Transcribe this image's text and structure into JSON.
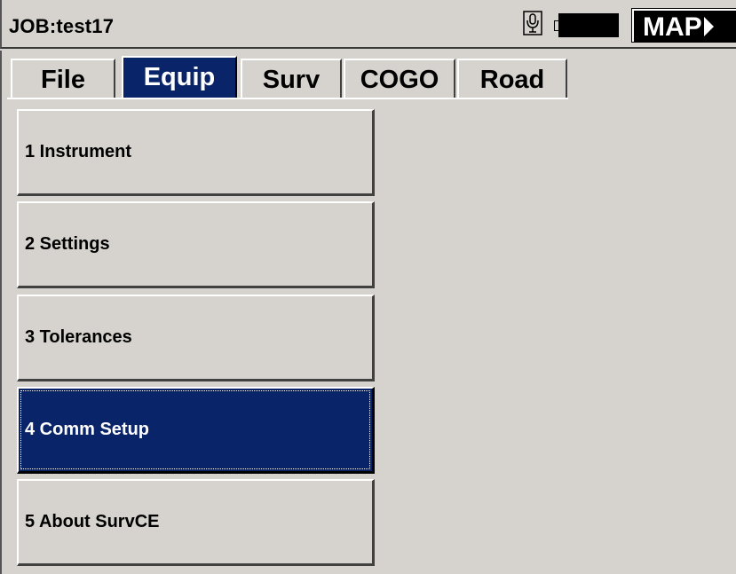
{
  "header": {
    "job_title": "JOB:test17",
    "map_label": "MAP",
    "icons": [
      "microphone-icon",
      "battery-icon",
      "map-arrow-icon"
    ]
  },
  "tabs": [
    {
      "label": "File",
      "active": false
    },
    {
      "label": "Equip",
      "active": true
    },
    {
      "label": "Surv",
      "active": false
    },
    {
      "label": "COGO",
      "active": false
    },
    {
      "label": "Road",
      "active": false
    }
  ],
  "menu": {
    "selected_index": 3,
    "items": [
      {
        "label": "1 Instrument"
      },
      {
        "label": "2 Settings"
      },
      {
        "label": "3 Tolerances"
      },
      {
        "label": "4 Comm Setup"
      },
      {
        "label": "5 About SurvCE"
      }
    ]
  },
  "colors": {
    "background": "#d6d3ce",
    "selection": "#0a246a",
    "text": "#000000",
    "selected_text": "#ffffff"
  }
}
